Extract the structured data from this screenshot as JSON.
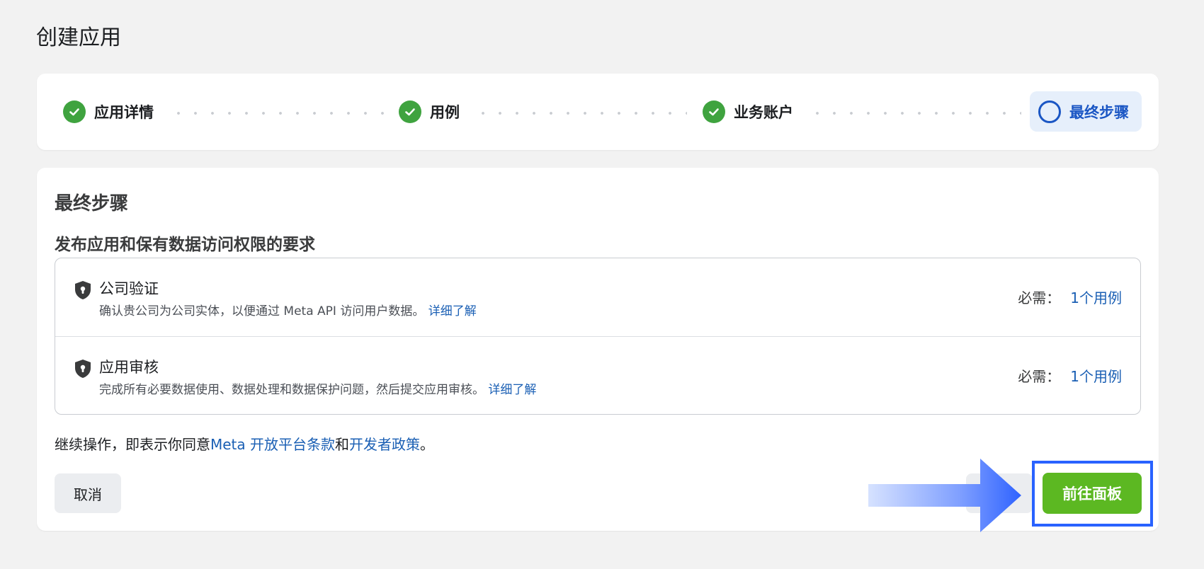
{
  "page": {
    "title": "创建应用"
  },
  "stepper": {
    "steps": [
      {
        "label": "应用详情",
        "status": "done"
      },
      {
        "label": "用例",
        "status": "done"
      },
      {
        "label": "业务账户",
        "status": "done"
      },
      {
        "label": "最终步骤",
        "status": "current"
      }
    ]
  },
  "main": {
    "section_title": "最终步骤",
    "requirements_title": "发布应用和保有数据访问权限的要求",
    "requirements": [
      {
        "name": "公司验证",
        "description": "确认贵公司为公司实体，以便通过 Meta API 访问用户数据。",
        "learn_more": "详细了解",
        "required_label": "必需：",
        "required_value": "1个用例"
      },
      {
        "name": "应用审核",
        "description": "完成所有必要数据使用、数据处理和数据保护问题，然后提交应用审核。",
        "learn_more": "详细了解",
        "required_label": "必需：",
        "required_value": "1个用例"
      }
    ],
    "agreement": {
      "prefix": "继续操作，即表示你同意",
      "terms_link": "Meta 开放平台条款",
      "conjunction": "和",
      "policy_link": "开发者政策",
      "suffix": "。"
    },
    "buttons": {
      "cancel": "取消",
      "go_dashboard": "前往面板"
    }
  },
  "colors": {
    "success": "#3fa33f",
    "accent": "#1a56c4",
    "primary_button": "#5cb822",
    "highlight": "#2962ff",
    "link": "#1a5fb4"
  },
  "icons": [
    "check-icon",
    "circle-icon",
    "shield-lock-icon",
    "arrow-right-icon"
  ]
}
